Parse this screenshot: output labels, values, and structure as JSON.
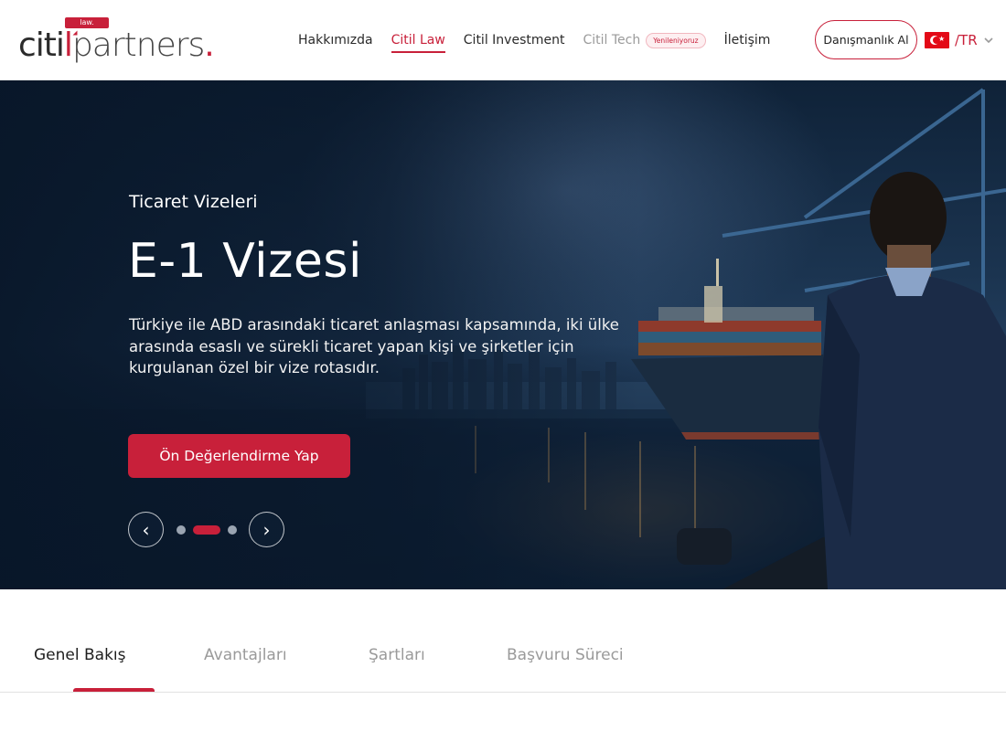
{
  "header": {
    "logo": {
      "tag": "law.",
      "brand_part1": "citi",
      "brand_part2": "partners",
      "brand_dot": "."
    },
    "nav": [
      {
        "label": "Hakkımızda"
      },
      {
        "label": "Citil Law"
      },
      {
        "label": "Citil Investment"
      },
      {
        "label": "Citil Tech"
      },
      {
        "label": "İletişim"
      }
    ],
    "nav_badge": "Yenileniyoruz",
    "cta_label": "Danışmanlık Al",
    "language": {
      "code": "/TR",
      "flag_icon": "turkey-flag-icon"
    }
  },
  "hero": {
    "eyebrow": "Ticaret Vizeleri",
    "title": "E-1 Vizesi",
    "description": "Türkiye ile ABD arasındaki ticaret anlaşması kapsamında, iki ülke arasında esaslı ve sürekli ticaret yapan kişi ve şirketler için kurgulanan özel bir vize rotasıdır.",
    "button_label": "Ön Değerlendirme Yap",
    "prev_symbol": "‹",
    "next_symbol": "›",
    "slides_total": 3,
    "active_slide": 2
  },
  "tabs": [
    {
      "label": "Genel Bakış"
    },
    {
      "label": "Avantajları"
    },
    {
      "label": "Şartları"
    },
    {
      "label": "Başvuru Süreci"
    }
  ],
  "colors": {
    "accent": "#c8203a",
    "hero_dark": "#0f2238",
    "text": "#222222",
    "muted": "#9a9a9a"
  }
}
